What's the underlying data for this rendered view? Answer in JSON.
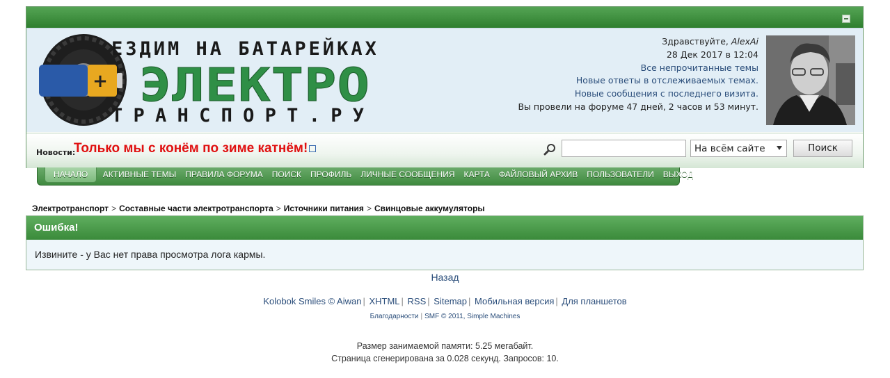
{
  "header": {
    "logo_line1": "ЕЗДИМ НА БАТАРЕЙКАХ",
    "logo_line2": "ЭЛЕКТРО",
    "logo_line3": "ТРАНСПОРТ.РУ",
    "greeting": "Здравствуйте,",
    "username": "AlexAi",
    "datetime": "28 Дек 2017 в 12:04",
    "link_unread": "Все непрочитанные темы",
    "link_replies": "Новые ответы в отслеживаемых темах.",
    "link_new_posts": "Новые сообщения с последнего визита.",
    "time_on_forum": "Вы провели на форуме 47 дней, 2 часов и 53 минут."
  },
  "news": {
    "label": "Новости:",
    "text": "Только мы с конём по зиме катнём!"
  },
  "search": {
    "placeholder": "",
    "scope": "На всём сайте",
    "button": "Поиск"
  },
  "menu": [
    {
      "label": "НАЧАЛО"
    },
    {
      "label": "АКТИВНЫЕ ТЕМЫ"
    },
    {
      "label": "ПРАВИЛА ФОРУМА"
    },
    {
      "label": "ПОИСК"
    },
    {
      "label": "ПРОФИЛЬ"
    },
    {
      "label": "ЛИЧНЫЕ СООБЩЕНИЯ"
    },
    {
      "label": "КАРТА"
    },
    {
      "label": "ФАЙЛОВЫЙ АРХИВ"
    },
    {
      "label": "ПОЛЬЗОВАТЕЛИ"
    },
    {
      "label": "ВЫХОД"
    }
  ],
  "breadcrumb": [
    {
      "label": "Электротранспорт"
    },
    {
      "label": "Составные части электротранспорта"
    },
    {
      "label": "Источники питания"
    },
    {
      "label": "Свинцовые аккумуляторы"
    }
  ],
  "error": {
    "title": "Ошибка!",
    "message": "Извините - у Вас нет права просмотра лога кармы."
  },
  "back_link": "Назад",
  "footer": {
    "links": [
      {
        "label": "Kolobok Smiles © Aiwan"
      },
      {
        "label": "XHTML"
      },
      {
        "label": "RSS"
      },
      {
        "label": "Sitemap"
      },
      {
        "label": "Мобильная версия"
      },
      {
        "label": "Для планшетов"
      }
    ],
    "credit_thanks": "Благодарности",
    "credit_smf": "SMF © 2011, Simple Machines",
    "memory": "Размер занимаемой памяти: 5.25 мегабайт.",
    "generated": "Страница сгенерирована за 0.028 секунд. Запросов: 10."
  },
  "colors": {
    "brand_green": "#3a8a3a",
    "news_red": "#e01010",
    "link_blue": "#2a4d7a"
  }
}
